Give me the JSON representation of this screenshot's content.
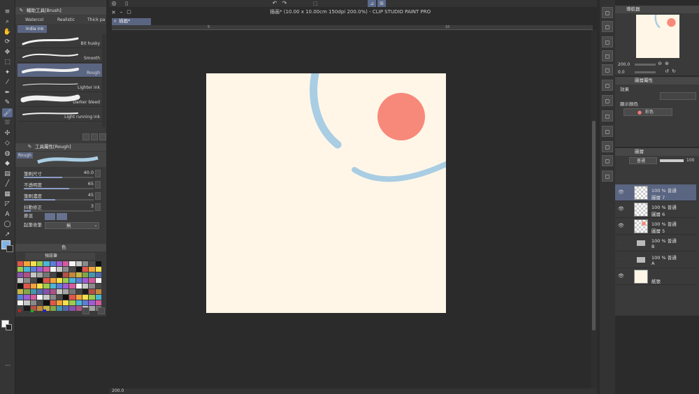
{
  "window": {
    "title": "插画* (10.00 x 10.00cm 150dpi 200.0%) - CLIP STUDIO PAINT PRO",
    "doc_tab": "插画*"
  },
  "colors": {
    "canvas_bg": "#fff6e8",
    "stroke_blue": "#a9cde3",
    "circle": "#f7897a",
    "selection": "#5a6582",
    "accent_blue": "#7fb4e6"
  },
  "tools": [
    "menu-icon",
    "zoom-icon",
    "hand-icon",
    "rotate-icon",
    "move-icon",
    "select-rect-icon",
    "magic-wand-icon",
    "eyedropper-icon",
    "pen-icon",
    "pencil-icon",
    "brush-icon",
    "airbrush-icon",
    "decoration-icon",
    "eraser-icon",
    "blend-icon",
    "fill-icon",
    "gradient-icon",
    "line-icon",
    "frame-icon",
    "ruler-icon",
    "text-icon",
    "balloon-icon",
    "correct-line-icon"
  ],
  "sub_tool": {
    "header": "輔助工具[Brush]",
    "tabs": [
      "Watercol",
      "Realistic",
      "Thick pa"
    ],
    "active_tab": "India ink",
    "brushes": [
      {
        "label": "Bit husky"
      },
      {
        "label": "Smooth"
      },
      {
        "label": "Rough"
      },
      {
        "label": "Lighter ink"
      },
      {
        "label": "Darker bleed"
      },
      {
        "label": "Light running ink"
      }
    ]
  },
  "tool_property": {
    "header": "工具屬性[Rough]",
    "preview_label": "Rough",
    "rows": [
      {
        "label": "筆刷尺寸",
        "value": "40.0",
        "level": 0.55
      },
      {
        "label": "不透明度",
        "value": "65",
        "level": 0.65
      },
      {
        "label": "筆刷濃度",
        "value": "45",
        "level": 0.45
      },
      {
        "label": "抖動修正",
        "value": "3",
        "level": 0.1
      }
    ],
    "blend_label": "摻混",
    "taper_label": "起筆收筆",
    "taper_value": "無"
  },
  "color_set": {
    "header": "色",
    "name": "預設筆"
  },
  "navigator": {
    "header": "導航器",
    "zoom": "200.0",
    "rotation": "0.0"
  },
  "layer_property": {
    "header": "圖層屬性",
    "effect_label": "效果",
    "display_color_label": "顯示顏色",
    "display_color_value": "彩色"
  },
  "layers_panel": {
    "header": "圖層",
    "blend_mode": "普通",
    "opacity": "100",
    "layers": [
      {
        "line1": "100 % 普通",
        "line2": "圖層 7",
        "visible": true,
        "selected": true,
        "type": "raster"
      },
      {
        "line1": "100 % 普通",
        "line2": "圖層 6",
        "visible": true,
        "selected": false,
        "type": "raster"
      },
      {
        "line1": "100 % 普通",
        "line2": "圖層 5",
        "visible": true,
        "selected": false,
        "type": "raster-red"
      },
      {
        "line1": "100 % 普通",
        "line2": "B",
        "visible": false,
        "selected": false,
        "type": "folder"
      },
      {
        "line1": "100 % 普通",
        "line2": "A",
        "visible": false,
        "selected": false,
        "type": "folder"
      },
      {
        "line1": "",
        "line2": "紙張",
        "visible": true,
        "selected": false,
        "type": "paper"
      }
    ]
  },
  "ruler": {
    "marks": [
      "5",
      "10"
    ]
  },
  "status": {
    "zoom": "200.0"
  }
}
